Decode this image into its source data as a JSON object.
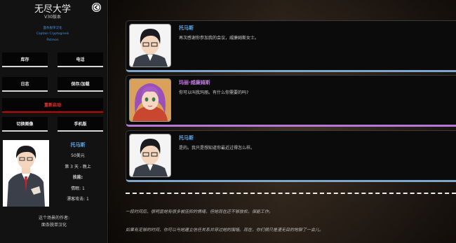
{
  "sidebar": {
    "title": "无尽大学",
    "version": "V30版本",
    "credits": [
      "面条脱单汉化",
      "Captain Cryptogreek",
      "Patreon"
    ],
    "menu": {
      "inventory": "库存",
      "phone": "电话",
      "journal": "日志",
      "save_load": "保存/加载",
      "restart": "重新启动",
      "switch_portrait": "切换图像",
      "mobile": "手机版"
    },
    "player": {
      "name": "托马斯",
      "money": "50美元",
      "time": "第 3 天 - 晚上",
      "skills_label": "技能:",
      "stamina": "情眠: 1",
      "attack": "漂客攻击: 1"
    },
    "author_label": "这个场景的作者:",
    "author_name": "面条脱单汉化"
  },
  "dialog": [
    {
      "speaker": "托马斯",
      "text": "再次感谢你参加我的会议，威廉姆斯女士。"
    },
    {
      "speaker": "玛丽·威廉姆斯",
      "text": "你可以叫我玛丽。有什么你需要的吗?"
    },
    {
      "speaker": "托马斯",
      "text": "是的。我只是想知道你最近过得怎么样。"
    }
  ],
  "narration": [
    "一段时间后，很明显她有很多被压抑的情绪，但她现在还不够放松，保能工作。",
    "如果有足够的时间，你可以与她建立信任关系并穿过她的围墙。现在，你们俩只是漫无目的地聊了一会儿。"
  ],
  "colors": {
    "sidebar_bg": "#121212",
    "link": "#4a90d9",
    "thomas_name": "#5aa9ea",
    "mary_name": "#c27be0",
    "restart": "#e33333"
  },
  "icons": {
    "back": "back-arrow-icon"
  }
}
